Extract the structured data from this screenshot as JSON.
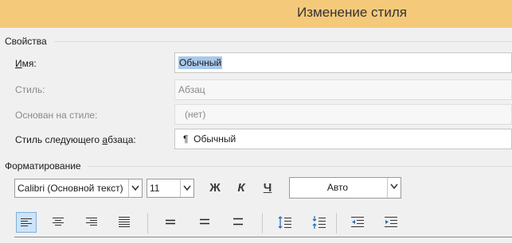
{
  "dialog": {
    "title": "Изменение стиля"
  },
  "properties": {
    "section_label": "Свойства",
    "name_label": "Имя:",
    "name_value": "Обычный",
    "style_type_label": "Стиль:",
    "style_type_value": "Абзац",
    "based_on_label": "Основан на стиле:",
    "based_on_value": "(нет)",
    "next_style_label": "Стиль следующего абзаца:",
    "next_style_value": "Обычный",
    "next_style_mark": "¶"
  },
  "formatting": {
    "section_label": "Форматирование",
    "font_name": "Calibri (Основной текст)",
    "font_size": "11",
    "bold_label": "Ж",
    "italic_label": "К",
    "underline_label": "Ч",
    "color_value": "Авто"
  },
  "colors": {
    "title_bar": "#f5c97a",
    "selection": "#a8c8ec",
    "active_button": "#cde3f6"
  }
}
